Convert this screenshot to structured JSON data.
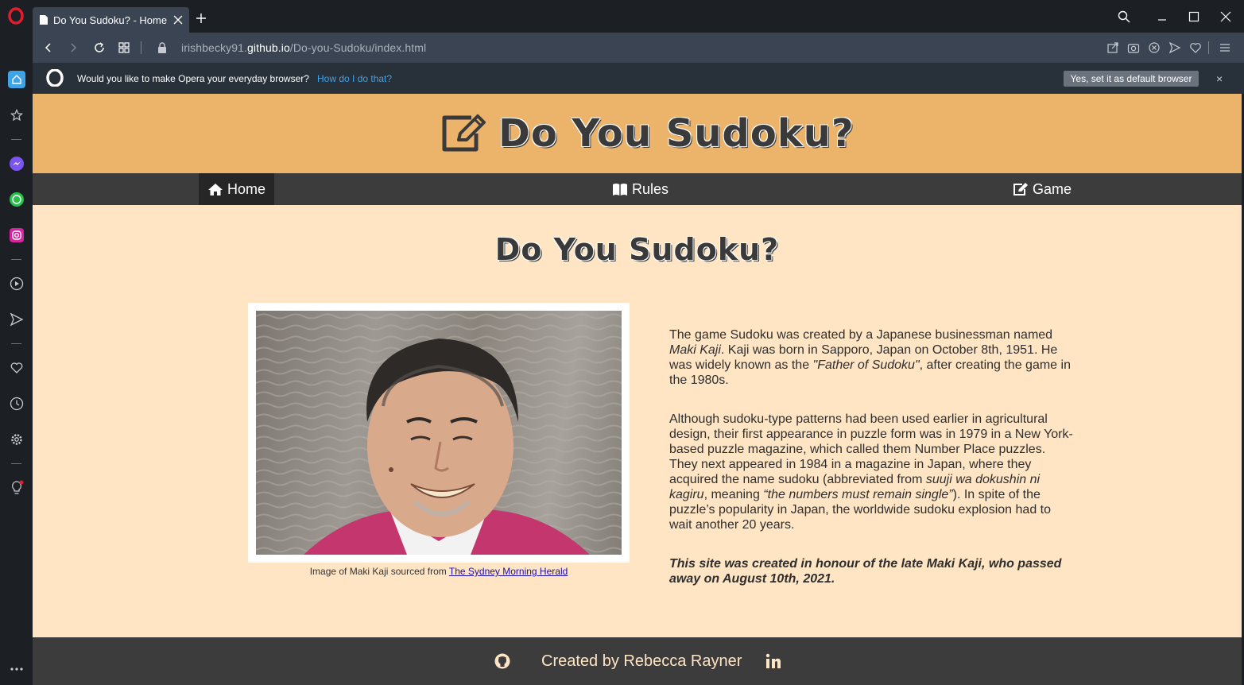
{
  "browser": {
    "tab": {
      "title": "Do You Sudoku? - Home"
    },
    "address": {
      "url_prefix": "irishbecky91.",
      "url_domain": "github.io",
      "url_path": "/Do-you-Sudoku/index.html"
    },
    "infobar": {
      "message": "Would you like to make Opera your everyday browser?",
      "link": "How do I do that?",
      "button": "Yes, set it as default browser",
      "close": "×"
    }
  },
  "sidebar": {
    "icons": [
      "home-icon",
      "star-icon",
      "messenger-icon",
      "whatsapp-icon",
      "instagram-icon",
      "player-icon",
      "send-icon",
      "heart-icon",
      "history-icon",
      "settings-icon",
      "bulb-icon",
      "more-icon"
    ]
  },
  "site": {
    "brand": "Do You Sudoku?",
    "nav": [
      {
        "label": "Home",
        "icon": "home-icon"
      },
      {
        "label": "Rules",
        "icon": "book-icon"
      },
      {
        "label": "Game",
        "icon": "edit-icon"
      }
    ],
    "page_title": "Do You Sudoku?",
    "caption_prefix": "Image of Maki Kaji sourced from ",
    "caption_link": "The Sydney Morning Herald",
    "para1": {
      "a": "The game Sudoku was created by a Japanese businessman named ",
      "name": "Maki Kaji",
      "b": ". Kaji was born in Sapporo, Japan on October 8th, 1951. He was widely known as the ",
      "quote": "\"Father of Sudoku\"",
      "c": ", after creating the game in the 1980s."
    },
    "para2": {
      "a": "Although sudoku-type patterns had been used earlier in agricultural design, their first appearance in puzzle form was in 1979 in a New York-based puzzle magazine, which called them Number Place puzzles. They next appeared in 1984 in a magazine in Japan, where they acquired the name sudoku (abbreviated from ",
      "jp": "suuji wa dokushin ni kagiru",
      "b": ", meaning ",
      "meaning": "“the numbers must remain single”",
      "c": "). In spite of the puzzle’s popularity in Japan, the worldwide sudoku explosion had to wait another 20 years."
    },
    "tribute": "This site was created in honour of the late Maki Kaji, who passed away on August 10th, 2021.",
    "footer": "Created by Rebecca Rayner"
  }
}
